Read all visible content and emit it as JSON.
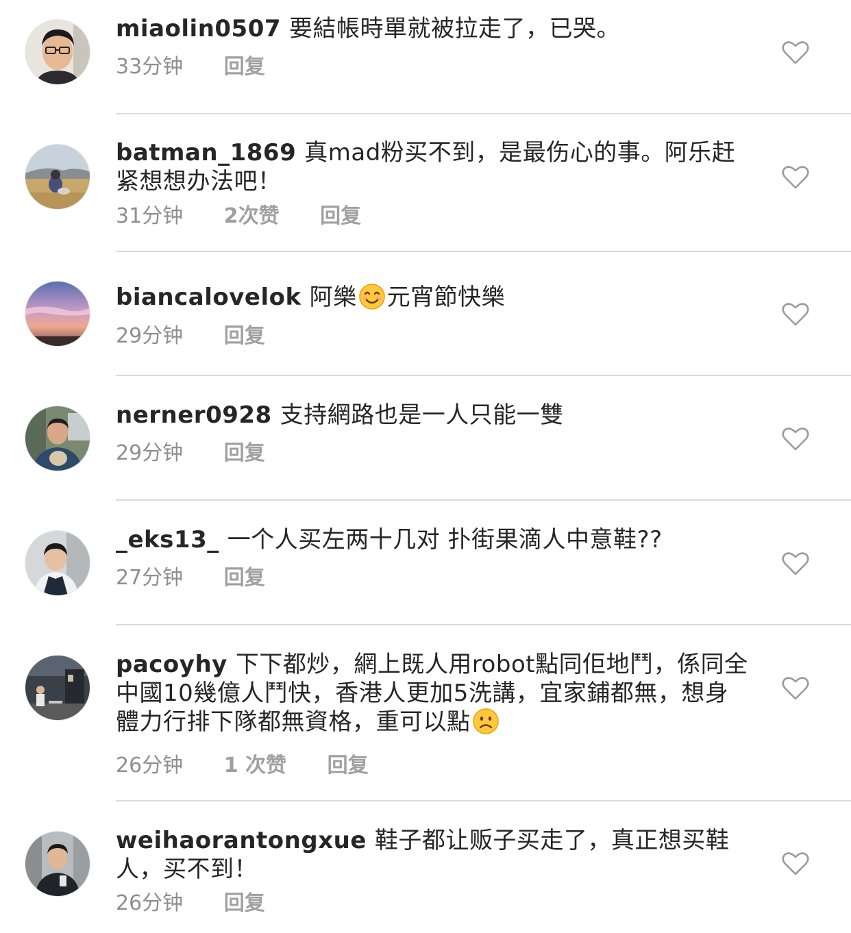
{
  "comments": [
    {
      "username": "miaolin0507",
      "text": "要結帳時單就被拉走了，已哭。",
      "time": "33分钟",
      "likes": "",
      "reply": "回复"
    },
    {
      "username": "batman_1869",
      "text": "真mad粉买不到，是最伤心的事。阿乐赶紧想想办法吧！",
      "time": "31分钟",
      "likes": "2次赞",
      "reply": "回复"
    },
    {
      "username": "biancalovelok",
      "text_before_emoji": "阿樂",
      "text_after_emoji": "元宵節快樂",
      "emoji": "smiling-face-emoji",
      "time": "29分钟",
      "likes": "",
      "reply": "回复"
    },
    {
      "username": "nerner0928",
      "text": "支持網路也是一人只能一雙",
      "time": "29分钟",
      "likes": "",
      "reply": "回复"
    },
    {
      "username": "_eks13_",
      "text": "一个人买左两十几对 扑街果滴人中意鞋??",
      "time": "27分钟",
      "likes": "",
      "reply": "回复"
    },
    {
      "username": "pacoyhy",
      "text": "下下都炒，網上既人用robot點同佢地鬥，係同全中國10幾億人鬥快，香港人更加5洗講，宜家鋪都無，想身體力行排下隊都無資格，重可以點",
      "emoji": "frowning-face-emoji",
      "time": "26分钟",
      "likes": "1 次赞",
      "reply": "回复"
    },
    {
      "username": "weihaorantongxue",
      "text": "鞋子都让贩子买走了，真正想买鞋人，买不到！",
      "time": "26分钟",
      "likes": "",
      "reply": "回复"
    }
  ],
  "colors": {
    "text": "#262626",
    "meta": "#8e8e8e",
    "divider": "#dbdbdb",
    "heart_outline": "#9b9b9b"
  },
  "icons": {
    "like": "heart-outline-icon"
  }
}
